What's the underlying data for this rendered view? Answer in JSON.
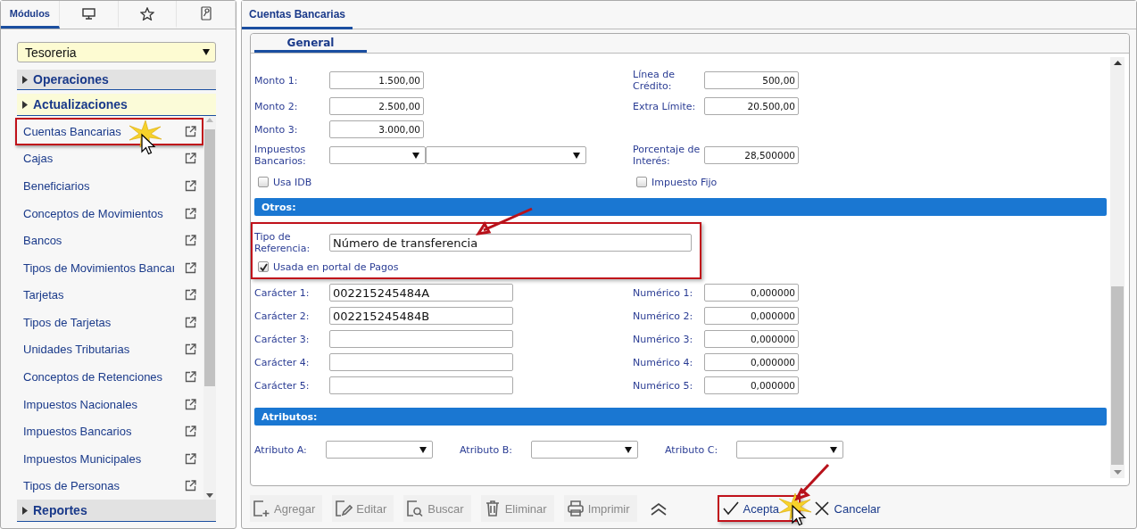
{
  "sidebar": {
    "tabs": [
      {
        "kind": "text",
        "label": "Módulos",
        "selected": true
      },
      {
        "kind": "monitor",
        "selected": false
      },
      {
        "kind": "star",
        "selected": false
      },
      {
        "kind": "key",
        "selected": false
      }
    ],
    "module_select": {
      "value": "Tesoreria"
    },
    "sections": [
      {
        "label": "Operaciones",
        "expanded": false
      },
      {
        "label": "Actualizaciones",
        "expanded": true,
        "items": [
          {
            "label": "Cuentas Bancarias",
            "highlighted": true
          },
          {
            "label": "Cajas",
            "highlighted": false
          },
          {
            "label": "Beneficiarios",
            "highlighted": false
          },
          {
            "label": "Conceptos de Movimientos",
            "highlighted": false
          },
          {
            "label": "Bancos",
            "highlighted": false
          },
          {
            "label": "Tipos de Movimientos Bancaı",
            "highlighted": false
          },
          {
            "label": "Tarjetas",
            "highlighted": false
          },
          {
            "label": "Tipos de Tarjetas",
            "highlighted": false
          },
          {
            "label": "Unidades Tributarias",
            "highlighted": false
          },
          {
            "label": "Conceptos de Retenciones",
            "highlighted": false
          },
          {
            "label": "Impuestos Nacionales",
            "highlighted": false
          },
          {
            "label": "Impuestos Bancarios",
            "highlighted": false
          },
          {
            "label": "Impuestos Municipales",
            "highlighted": false
          },
          {
            "label": "Tipos de Personas",
            "highlighted": false
          }
        ]
      },
      {
        "label": "Reportes",
        "expanded": false
      }
    ]
  },
  "main": {
    "tabs": [
      {
        "label": "Cuentas Bancarias",
        "selected": true
      }
    ],
    "subtabs": [
      {
        "label": "General",
        "selected": true
      }
    ],
    "amounts": [
      {
        "label": "Monto 1:",
        "value": "1.500,00"
      },
      {
        "label": "Monto 2:",
        "value": "2.500,00"
      },
      {
        "label": "Monto 3:",
        "value": "3.000,00"
      }
    ],
    "right_fields": [
      {
        "label": "Línea de Crédito:",
        "value": "500,00"
      },
      {
        "label": "Extra Límite:",
        "value": "20.500,00"
      },
      {
        "label": "Porcentaje de Interés:",
        "value": "28,500000"
      }
    ],
    "taxes_label": "Impuestos Bancarios:",
    "checks": [
      {
        "label": "Usa IDB",
        "checked": false
      },
      {
        "label": "Impuesto Fijo",
        "checked": false
      }
    ],
    "otros": {
      "title": "Otros:",
      "reference_label": "Tipo de Referencia:",
      "reference_value": "Número de transferencia",
      "highlighted": true,
      "portal_check": {
        "label": "Usada en portal de Pagos",
        "checked": true
      },
      "character_fields": [
        {
          "label": "Carácter 1:",
          "value": "002215245484A"
        },
        {
          "label": "Carácter 2:",
          "value": "002215245484B"
        },
        {
          "label": "Carácter 3:"
        },
        {
          "label": "Carácter 4:"
        },
        {
          "label": "Carácter 5:"
        }
      ],
      "numeric_fields": [
        {
          "label": "Numérico 1:",
          "value": "0,000000"
        },
        {
          "label": "Numérico 2:",
          "value": "0,000000"
        },
        {
          "label": "Numérico 3:",
          "value": "0,000000"
        },
        {
          "label": "Numérico 4:",
          "value": "0,000000"
        },
        {
          "label": "Numérico 5:",
          "value": "0,000000"
        }
      ]
    },
    "atributos": {
      "title": "Atributos:",
      "fields": [
        {
          "label": "Atributo A:"
        },
        {
          "label": "Atributo B:"
        },
        {
          "label": "Atributo C:"
        }
      ]
    },
    "toolbar": [
      {
        "kind": "add",
        "label": "Agregar",
        "disabled": true
      },
      {
        "kind": "edit",
        "label": "Editar",
        "disabled": true
      },
      {
        "kind": "search",
        "label": "Buscar",
        "disabled": true
      },
      {
        "kind": "delete",
        "label": "Eliminar",
        "disabled": true
      },
      {
        "kind": "print",
        "label": "Imprimir",
        "disabled": true
      },
      {
        "kind": "collapse",
        "disabled": false
      },
      {
        "kind": "accept",
        "label": "Acepta",
        "disabled": false,
        "highlighted": true
      },
      {
        "kind": "cancel",
        "label": "Cancelar",
        "disabled": false
      }
    ]
  }
}
